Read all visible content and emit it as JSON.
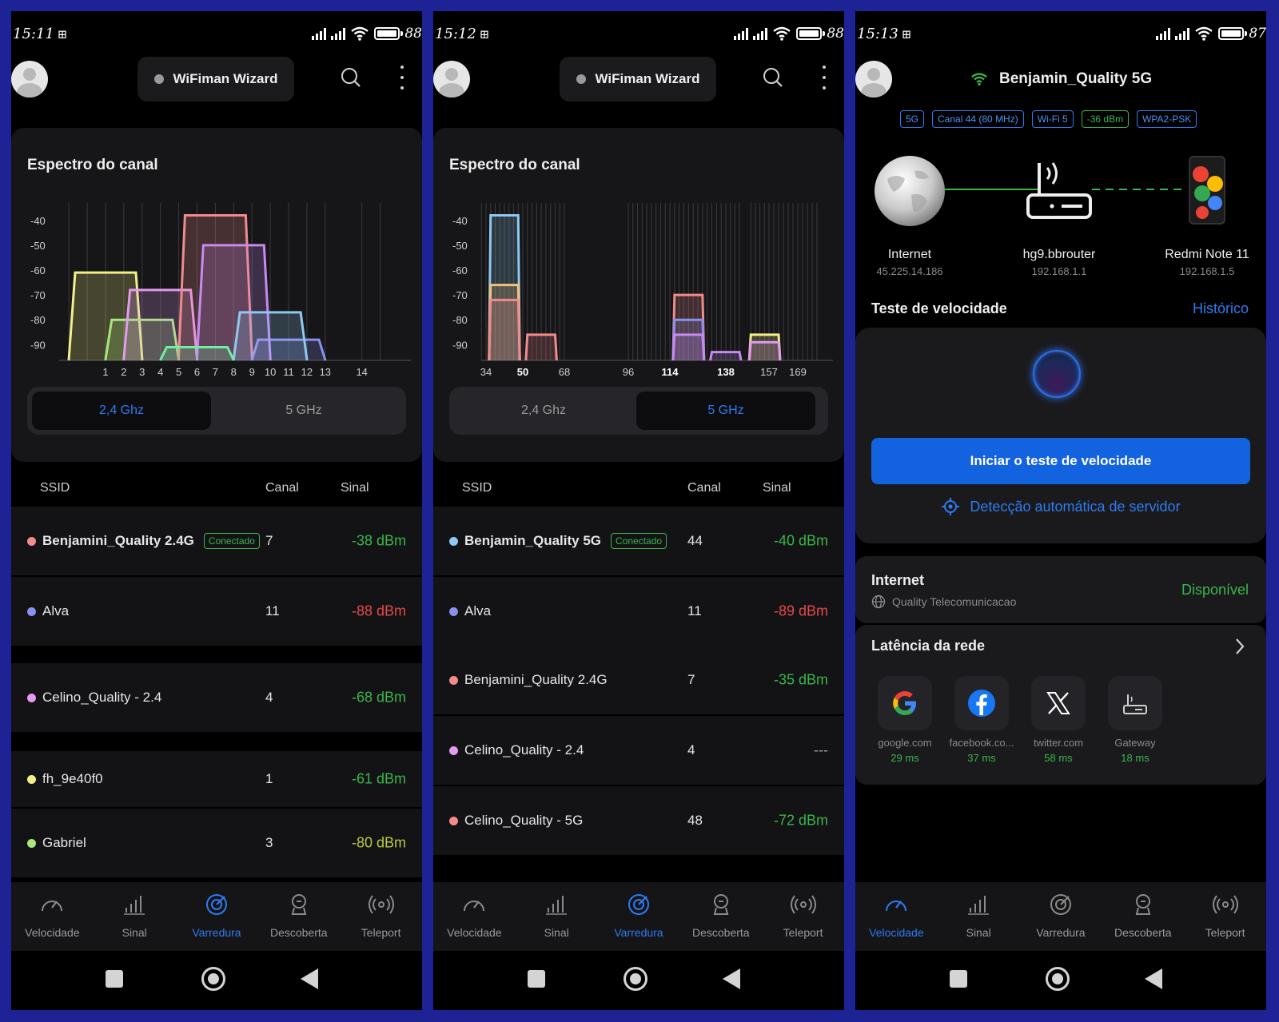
{
  "colors": {
    "accent": "#2d7bf2",
    "good": "#39b54a",
    "bad": "#e5484d",
    "warn": "#b8c93a",
    "background_frame": "#1d2394"
  },
  "phone1": {
    "status": {
      "time": "15:11",
      "battery": "88"
    },
    "wizard_label": "WiFiman Wizard",
    "card_title": "Espectro do canal",
    "segment": {
      "left": "2,4 Ghz",
      "right": "5 GHz",
      "active": "left"
    },
    "table_headers": {
      "ssid": "SSID",
      "channel": "Canal",
      "signal": "Sinal"
    },
    "rows": [
      {
        "ssid": "Benjamini_Quality 2.4G",
        "badge": "Conectado",
        "channel": "7",
        "signal": "-38 dBm",
        "dot": "#f28b8b",
        "signal_color": "#39b54a"
      },
      {
        "ssid": "Alva",
        "channel": "11",
        "signal": "-88 dBm",
        "dot": "#8d8ff0",
        "signal_color": "#e5484d"
      },
      {
        "ssid": "Celino_Quality - 2.4",
        "channel": "4",
        "signal": "-68 dBm",
        "dot": "#e49af0",
        "signal_color": "#39b54a"
      },
      {
        "ssid": "fh_9e40f0",
        "channel": "1",
        "signal": "-61 dBm",
        "dot": "#f1f08a",
        "signal_color": "#39b54a"
      },
      {
        "ssid": "Gabriel",
        "channel": "3",
        "signal": "-80 dBm",
        "dot": "#a8e87a",
        "signal_color": "#b8c93a"
      }
    ],
    "chart_data": {
      "type": "area",
      "title": "Espectro do canal",
      "y_ticks": [
        "-40",
        "-50",
        "-60",
        "-70",
        "-80",
        "-90"
      ],
      "x_ticks": [
        "1",
        "2",
        "3",
        "4",
        "5",
        "6",
        "7",
        "8",
        "9",
        "10",
        "11",
        "12",
        "13",
        "14"
      ],
      "ylim": [
        -96,
        -33
      ],
      "series": [
        {
          "name": "fh_9e40f0",
          "channel": 1,
          "dbm": -61,
          "color": "#f1f08a"
        },
        {
          "name": "Gabriel",
          "channel": 3,
          "dbm": -80,
          "color": "#a8e87a"
        },
        {
          "name": "Celino_Quality - 2.4",
          "channel": 4,
          "dbm": -68,
          "color": "#e49af0"
        },
        {
          "name": "Benjamini_Quality 2.4G",
          "channel": 7,
          "dbm": -38,
          "color": "#f28b8b"
        },
        {
          "name": "Alva",
          "channel": 11,
          "dbm": -88,
          "color": "#8d8ff0"
        },
        {
          "channel": 8,
          "dbm": -50,
          "color": "#c78af2"
        },
        {
          "channel": 10,
          "dbm": -77,
          "color": "#8ec9f2"
        },
        {
          "channel": 6,
          "dbm": -91,
          "color": "#6ef0a0"
        }
      ]
    }
  },
  "phone2": {
    "status": {
      "time": "15:12",
      "battery": "88"
    },
    "wizard_label": "WiFiman Wizard",
    "card_title": "Espectro do canal",
    "segment": {
      "left": "2,4 Ghz",
      "right": "5 GHz",
      "active": "right"
    },
    "table_headers": {
      "ssid": "SSID",
      "channel": "Canal",
      "signal": "Sinal"
    },
    "rows": [
      {
        "ssid": "Benjamin_Quality 5G",
        "badge": "Conectado",
        "channel": "44",
        "signal": "-40 dBm",
        "dot": "#8ec9f2",
        "signal_color": "#39b54a"
      },
      {
        "ssid": "Alva",
        "channel": "11",
        "signal": "-89 dBm",
        "dot": "#8d8ff0",
        "signal_color": "#e5484d"
      },
      {
        "ssid": "Benjamini_Quality 2.4G",
        "channel": "7",
        "signal": "-35 dBm",
        "dot": "#f28b8b",
        "signal_color": "#39b54a"
      },
      {
        "ssid": "Celino_Quality - 2.4",
        "channel": "4",
        "signal": "---",
        "dot": "#e49af0",
        "signal_color": "#9a9a9a"
      },
      {
        "ssid": "Celino_Quality - 5G",
        "channel": "48",
        "signal": "-72 dBm",
        "dot": "#f28b8b",
        "signal_color": "#39b54a"
      }
    ],
    "chart_data": {
      "type": "area",
      "title": "Espectro do canal",
      "y_ticks": [
        "-40",
        "-50",
        "-60",
        "-70",
        "-80",
        "-90"
      ],
      "x_ticks": [
        "34",
        "50",
        "68",
        "96",
        "114",
        "138",
        "157",
        "169"
      ],
      "bold_ticks": [
        "50",
        "114",
        "138"
      ],
      "ylim": [
        -96,
        -33
      ],
      "series": [
        {
          "name": "Benjamin_Quality 5G",
          "from": 36,
          "to": 48,
          "dbm": -38,
          "color": "#8ec9f2"
        },
        {
          "from": 36,
          "to": 48,
          "dbm": -66,
          "color": "#f2c27a"
        },
        {
          "name": "Celino_Quality - 5G",
          "from": 36,
          "to": 48,
          "dbm": -72,
          "color": "#f28b8b"
        },
        {
          "from": 52,
          "to": 64,
          "dbm": -86,
          "color": "#f28b8b"
        },
        {
          "from": 116,
          "to": 128,
          "dbm": -70,
          "color": "#f28b8b"
        },
        {
          "from": 116,
          "to": 128,
          "dbm": -80,
          "color": "#8d8ff0"
        },
        {
          "from": 116,
          "to": 128,
          "dbm": -86,
          "color": "#c78af2"
        },
        {
          "from": 132,
          "to": 144,
          "dbm": -93,
          "color": "#c78af2"
        },
        {
          "from": 149,
          "to": 161,
          "dbm": -86,
          "color": "#f1f08a"
        },
        {
          "from": 149,
          "to": 161,
          "dbm": -89,
          "color": "#e49af0"
        }
      ]
    }
  },
  "phone3": {
    "status": {
      "time": "15:13",
      "battery": "87"
    },
    "ssid": "Benjamin_Quality 5G",
    "tags": [
      "5G",
      "Canal 44 (80 MHz)",
      "Wi-Fi 5",
      "-36 dBm",
      "WPA2-PSK"
    ],
    "topology": {
      "internet": {
        "label": "Internet",
        "ip": "45.225.14.186"
      },
      "router": {
        "label": "hg9.bbrouter",
        "ip": "192.168.1.1"
      },
      "device": {
        "label": "Redmi Note 11",
        "ip": "192.168.1.5"
      }
    },
    "speed_title": "Teste de velocidade",
    "history": "Histórico",
    "start_button": "Iniciar o teste de velocidade",
    "auto_detect": "Detecção automática de servidor",
    "internet": {
      "title": "Internet",
      "isp": "Quality Telecomunicacao",
      "status": "Disponível"
    },
    "latency": {
      "title": "Latência da rede",
      "items": [
        {
          "name": "google.com",
          "ms": "29 ms",
          "icon": "google-icon"
        },
        {
          "name": "facebook.co...",
          "ms": "37 ms",
          "icon": "facebook-icon"
        },
        {
          "name": "twitter.com",
          "ms": "58 ms",
          "icon": "x-icon"
        },
        {
          "name": "Gateway",
          "ms": "18 ms",
          "icon": "gateway-icon"
        }
      ]
    }
  },
  "nav": [
    "Velocidade",
    "Sinal",
    "Varredura",
    "Descoberta",
    "Teleport"
  ]
}
